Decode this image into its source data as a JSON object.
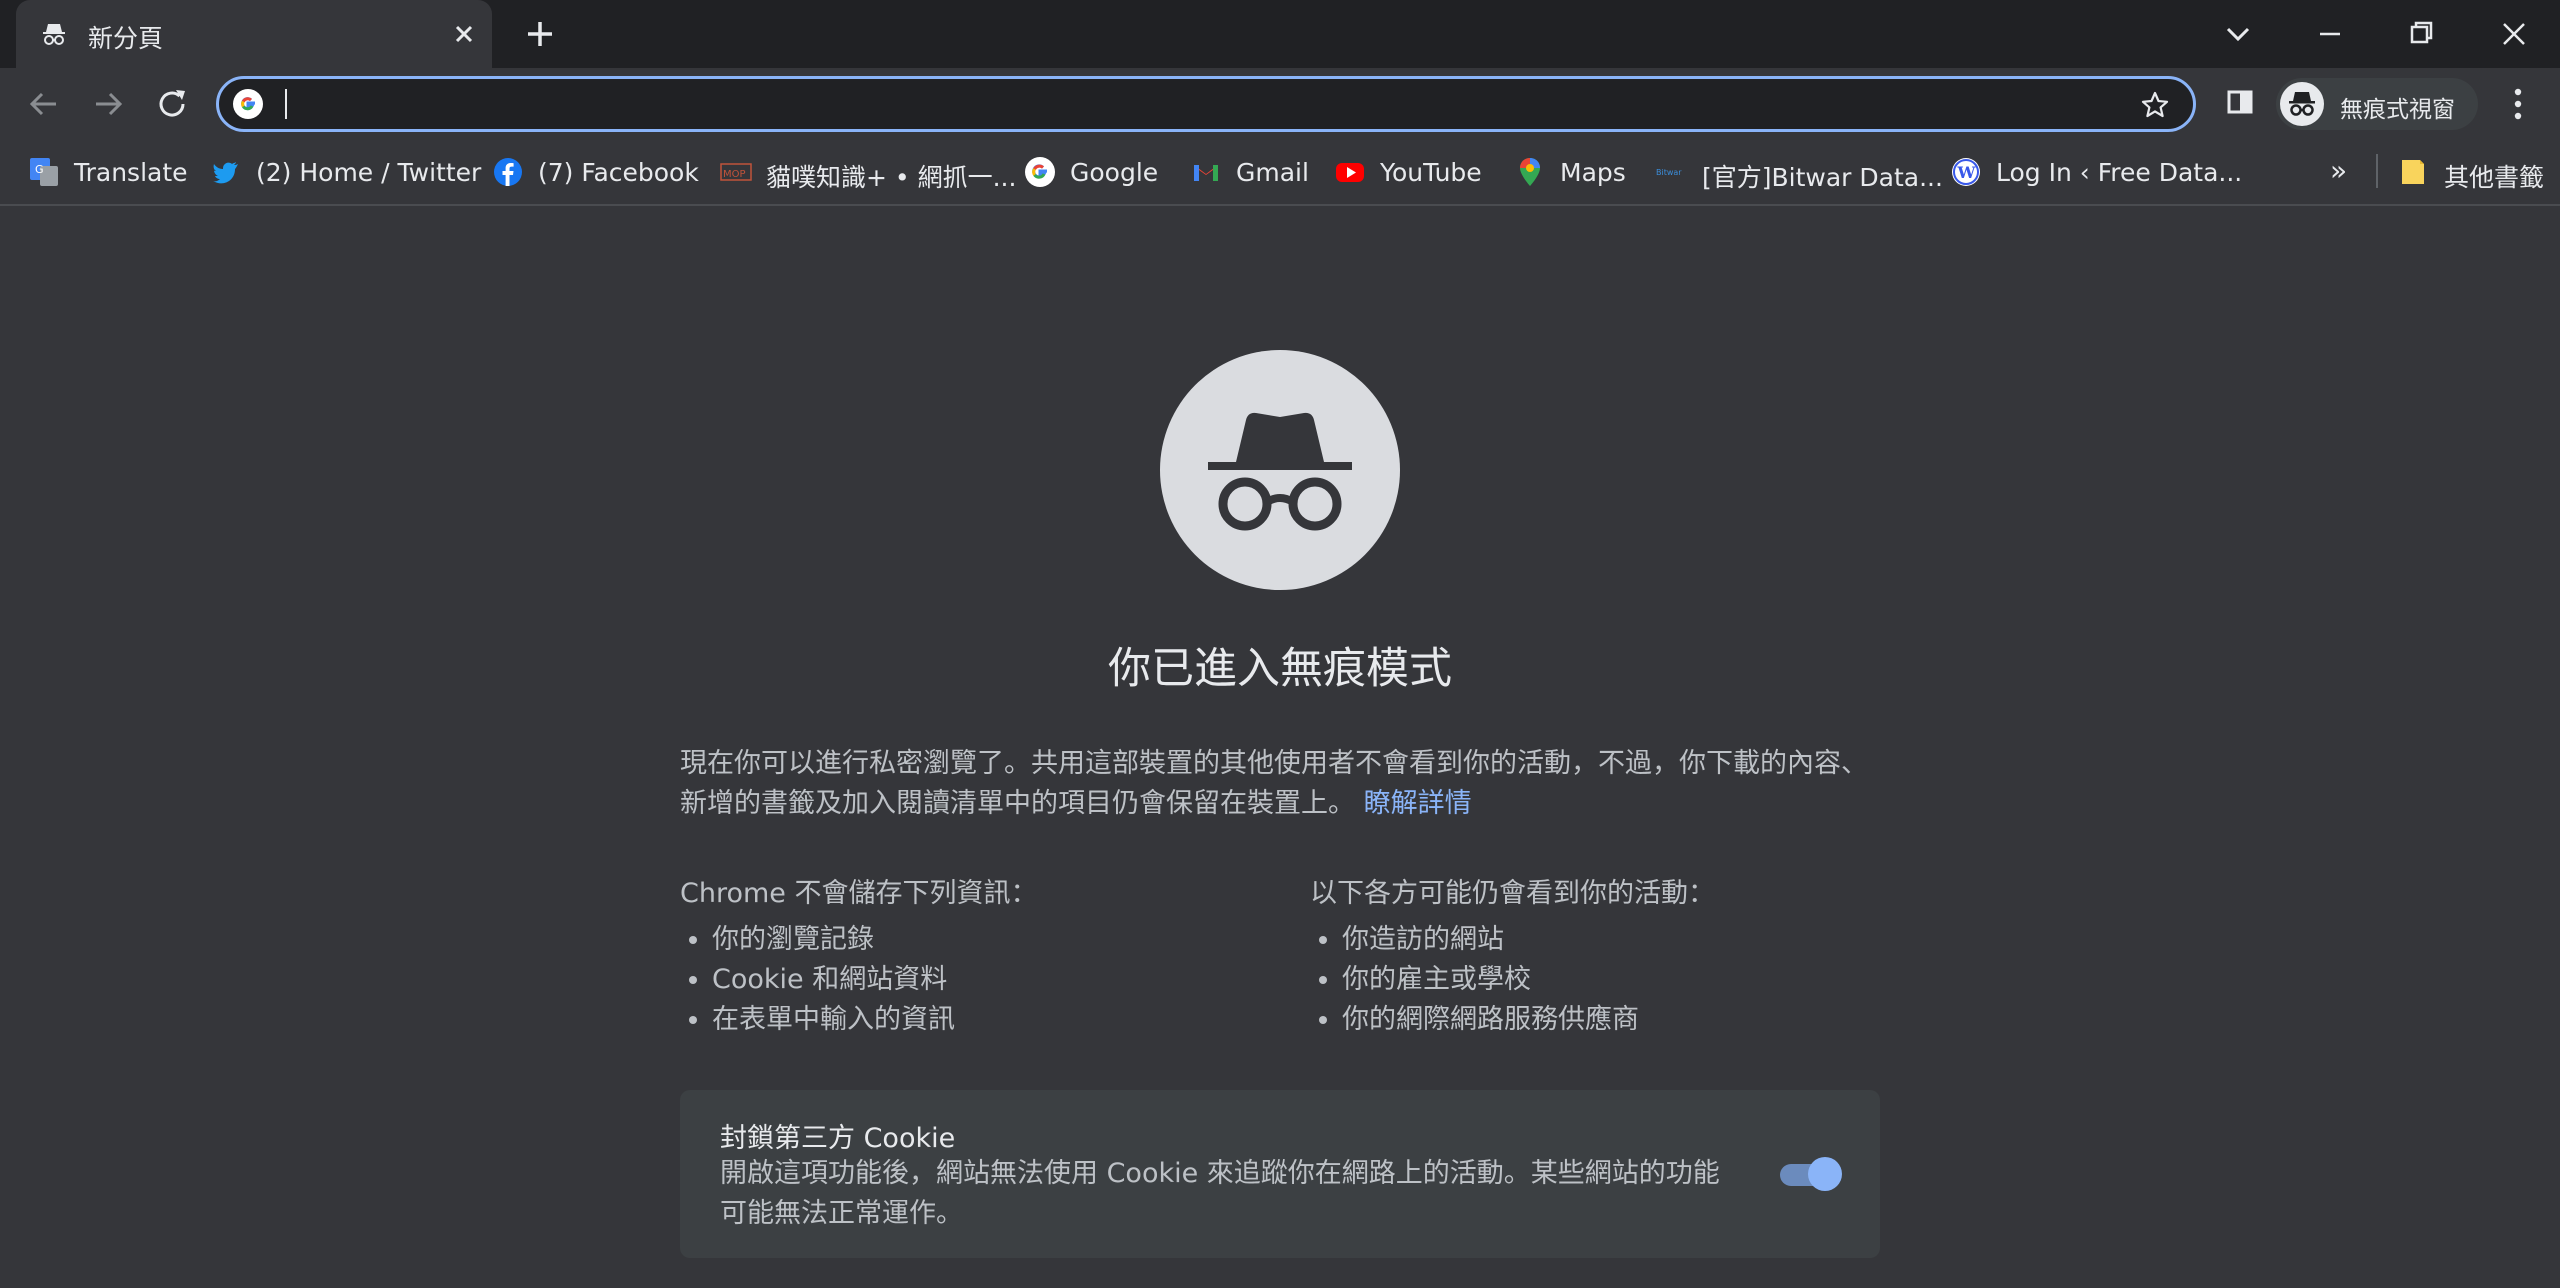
{
  "tab": {
    "title": "新分頁",
    "icon": "incognito-icon"
  },
  "toolbar": {
    "url_value": "",
    "url_placeholder": "",
    "profile_label": "無痕式視窗"
  },
  "bookmarks": {
    "items": [
      {
        "label": "Translate",
        "icon": "google-translate-icon"
      },
      {
        "label": "(2) Home / Twitter",
        "icon": "twitter-icon"
      },
      {
        "label": "(7) Facebook",
        "icon": "facebook-icon"
      },
      {
        "label": "貓噗知識+ • 網抓一...",
        "icon": "mop-icon"
      },
      {
        "label": "Google",
        "icon": "google-icon"
      },
      {
        "label": "Gmail",
        "icon": "gmail-icon"
      },
      {
        "label": "YouTube",
        "icon": "youtube-icon"
      },
      {
        "label": "Maps",
        "icon": "maps-icon"
      },
      {
        "label": "[官方]Bitwar Data...",
        "icon": "bitwar-icon"
      },
      {
        "label": "Log In ‹ Free Data...",
        "icon": "wordpress-icon"
      }
    ],
    "overflow": "»",
    "other_folder": "其他書籤"
  },
  "main": {
    "heading": "你已進入無痕模式",
    "description": "現在你可以進行私密瀏覽了。共用這部裝置的其他使用者不會看到你的活動，不過，你下載的內容、新增的書籤及加入閱讀清單中的項目仍會保留在裝置上。",
    "learn_more": "瞭解詳情",
    "left_col": {
      "title": "Chrome 不會儲存下列資訊：",
      "items": [
        "你的瀏覽記錄",
        "Cookie 和網站資料",
        "在表單中輸入的資訊"
      ]
    },
    "right_col": {
      "title": "以下各方可能仍會看到你的活動：",
      "items": [
        "你造訪的網站",
        "你的雇主或學校",
        "你的網際網路服務供應商"
      ]
    },
    "cookie_card": {
      "title": "封鎖第三方 Cookie",
      "body": "開啟這項功能後，網站無法使用 Cookie 來追蹤你在網路上的活動。某些網站的功能可能無法正常運作。",
      "toggle_on": true
    }
  },
  "colors": {
    "accent": "#8ab4f8",
    "page_bg": "#35363a",
    "frame_bg": "#202124"
  }
}
